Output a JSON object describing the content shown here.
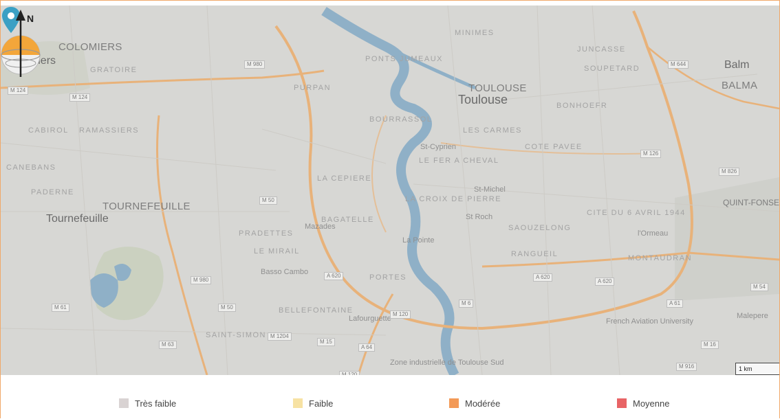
{
  "map": {
    "labels": {
      "colomiers": "Colomiers",
      "colomiers_caps": "COLOMIERS",
      "toulouse": "Toulouse",
      "toulouse_caps": "TOULOUSE",
      "tournefeuille": "Tournefeuille",
      "tournefeuille_caps": "TOURNEFEUILLE",
      "balma": "BALMA",
      "balm": "Balm",
      "quint": "QUINT-FONSE",
      "minimes": "MINIMES",
      "jumcasse": "JUNCASSE",
      "soupetard": "SOUPETARD",
      "bonnefoy": "BONHOEFR",
      "bourrassol": "BOURRASSOL",
      "lescarmes": "LES CARMES",
      "cotepavee": "COTE PAVEE",
      "lacepiere": "LA CEPIERE",
      "bagatelle": "BAGATELLE",
      "lacroix": "LA CROIX DE PIERRE",
      "rangueil": "RANGUEIL",
      "montaudran": "MONTAUDRAN",
      "saouzelong": "SAOUZELONG",
      "lemirail": "LE MIRAIL",
      "bellefontaine": "BELLEFONTAINE",
      "stsimon": "SAINT-SIMON",
      "portes": "PORTES",
      "pradettes": "PRADETTES",
      "cabirol": "CABIROL",
      "ramassiers": "RAMASSIERS",
      "paderne": "PADERNE",
      "canebans": "CANEBANS",
      "gratoire": "GRATOIRE",
      "purpan": "PURPAN",
      "ponts": "PONTS JUMEAUX",
      "cite": "CITE DU 6 AVRIL 1944",
      "stcyprien": "St-Cyprien",
      "stmichel": "St-Michel",
      "laferet": "LE FER A CHEVAL",
      "lapointe": "La Pointe",
      "stroch": "St Roch",
      "montaudran2": "l'Ormeau",
      "basso": "Basso Cambo",
      "mazades": "Mazades",
      "lafourguette": "Lafourguette",
      "zone": "Zone industrielle de Toulouse Sud",
      "frenchaviation": "French Aviation University",
      "malepere": "Malepere"
    },
    "road_shields": [
      "M 124",
      "M 124",
      "M 980",
      "M 50",
      "M 980",
      "M 120",
      "A 620",
      "A 620",
      "M 6",
      "M 1204",
      "M 15",
      "A 64",
      "M 120",
      "M 63",
      "M 61",
      "M 50",
      "M 826",
      "M 126",
      "M 644",
      "A 620",
      "A 61",
      "M 16",
      "M 916",
      "M 54"
    ],
    "scale_label": "1 km",
    "compass_label": "N",
    "colors": {
      "base": "#d7d7d4",
      "water": "#8fb0c7",
      "roads_major": "#e8b27a",
      "green": "#c9cfbd",
      "pin": "#3ba0c4"
    }
  },
  "legend": {
    "items": [
      {
        "label": "Très faible",
        "color": "#d9d3d3"
      },
      {
        "label": "Faible",
        "color": "#f7e2a3"
      },
      {
        "label": "Modérée",
        "color": "#f39a57"
      },
      {
        "label": "Moyenne",
        "color": "#e86466"
      }
    ]
  }
}
